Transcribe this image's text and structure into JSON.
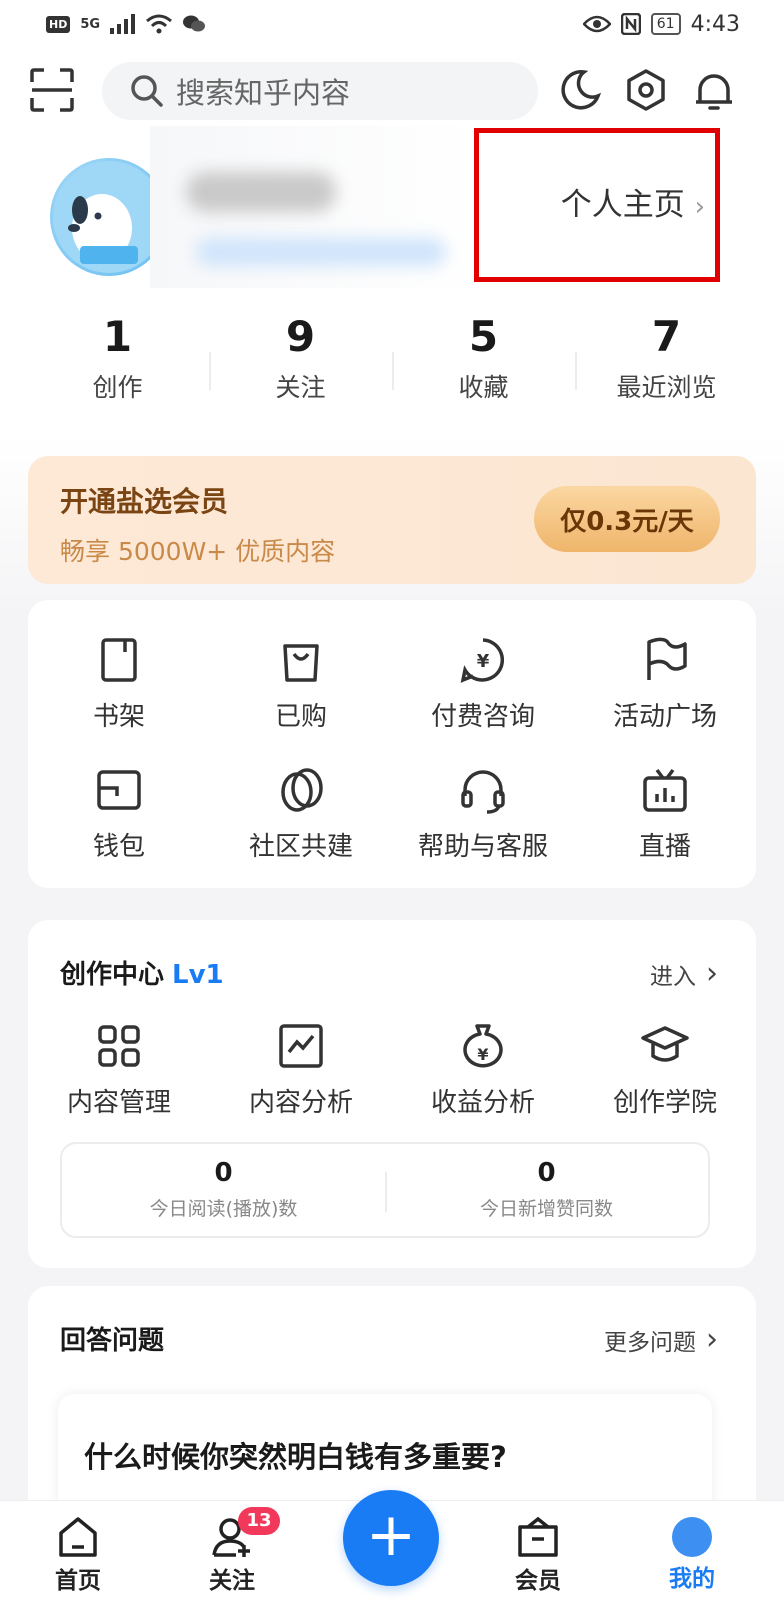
{
  "status_bar": {
    "hd": "HD",
    "signal": "5G",
    "battery": "61",
    "time": "4:43"
  },
  "header": {
    "search_placeholder": "搜索知乎内容"
  },
  "profile": {
    "home_link": "个人主页"
  },
  "stats": [
    {
      "value": "1",
      "label": "创作"
    },
    {
      "value": "9",
      "label": "关注"
    },
    {
      "value": "5",
      "label": "收藏"
    },
    {
      "value": "7",
      "label": "最近浏览"
    }
  ],
  "vip": {
    "title": "开通盐选会员",
    "subtitle": "畅享 5000W+ 优质内容",
    "button": "仅0.3元/天"
  },
  "services": [
    {
      "label": "书架",
      "icon": "bookshelf-icon"
    },
    {
      "label": "已购",
      "icon": "shopping-bag-icon"
    },
    {
      "label": "付费咨询",
      "icon": "paid-consult-icon"
    },
    {
      "label": "活动广场",
      "icon": "flag-icon"
    },
    {
      "label": "钱包",
      "icon": "wallet-icon"
    },
    {
      "label": "社区共建",
      "icon": "leaf-icon"
    },
    {
      "label": "帮助与客服",
      "icon": "headset-icon"
    },
    {
      "label": "直播",
      "icon": "tv-icon"
    }
  ],
  "creation": {
    "title": "创作中心",
    "level": "Lv1",
    "enter": "进入",
    "items": [
      {
        "label": "内容管理",
        "icon": "grid-icon"
      },
      {
        "label": "内容分析",
        "icon": "chart-icon"
      },
      {
        "label": "收益分析",
        "icon": "money-bag-icon"
      },
      {
        "label": "创作学院",
        "icon": "graduation-cap-icon"
      }
    ],
    "today": [
      {
        "value": "0",
        "label": "今日阅读(播放)数"
      },
      {
        "value": "0",
        "label": "今日新增赞同数"
      }
    ]
  },
  "answer": {
    "title": "回答问题",
    "more": "更多问题",
    "question": "什么时候你突然明白钱有多重要?"
  },
  "tabs": [
    {
      "label": "首页"
    },
    {
      "label": "关注",
      "badge": "13"
    },
    {
      "label": "会员"
    },
    {
      "label": "我的"
    }
  ],
  "colors": {
    "accent": "#1a7cf5",
    "highlight_box": "#e00000",
    "badge": "#f2395b",
    "vip_text": "#7a4513"
  }
}
